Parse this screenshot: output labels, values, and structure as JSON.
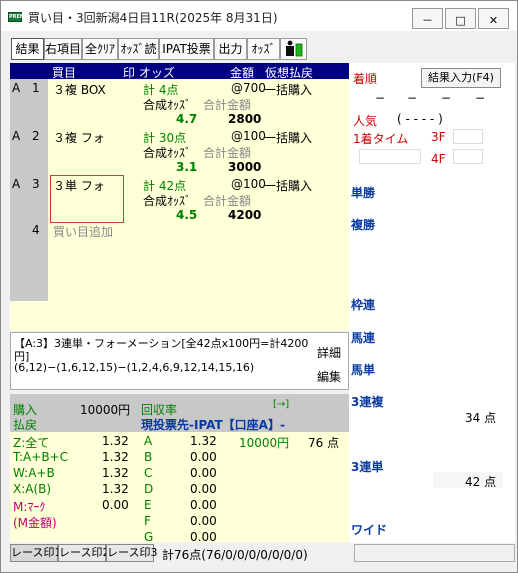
{
  "window": {
    "title": "買い目・3回新潟4日目11R(2025年 8月31日)",
    "app_icon_label": "PREM",
    "controls": {
      "minimize": "－",
      "maximize": "□",
      "close": "✕"
    }
  },
  "toolbar": {
    "buttons": [
      "結果",
      "右項目",
      "全ｸﾘｱ",
      "ｵｯｽﾞ読",
      "IPAT投票",
      "出力",
      "ｵｯｽﾞ"
    ]
  },
  "grid_header": {
    "col1": "買目",
    "col2": "印 オッズ",
    "col3": "金額",
    "col4": "仮想払戻"
  },
  "bets": [
    {
      "group": "A",
      "no": "1",
      "type": "３複 BOX",
      "count": "計  4点",
      "price": "@700",
      "mode": "一括購入",
      "odds_label": "合成ｵｯｽﾞ",
      "total_label": "合計金額",
      "odds": "4.7",
      "total": "2800"
    },
    {
      "group": "A",
      "no": "2",
      "type": "３複 フォ",
      "count": "計 30点",
      "price": "@100",
      "mode": "一括購入",
      "odds_label": "合成ｵｯｽﾞ",
      "total_label": "合計金額",
      "odds": "3.1",
      "total": "3000"
    },
    {
      "group": "A",
      "no": "3",
      "type": "３単 フォ",
      "count": "計 42点",
      "price": "@100",
      "mode": "一括購入",
      "odds_label": "合成ｵｯｽﾞ",
      "total_label": "合計金額",
      "odds": "4.5",
      "total": "4200"
    }
  ],
  "add_row": {
    "no": "4",
    "label": "買い目追加"
  },
  "info": {
    "line1": "【A:3】3連単・フォーメーション[全42点x100円=計4200",
    "line2": "円]",
    "line3": "(6,12)−(1,6,12,15)−(1,2,4,6,9,12,14,15,16)",
    "detail_btn": "詳細",
    "edit_btn": "編集"
  },
  "summary": {
    "purchase_label": "購入",
    "purchase_value": "10000円",
    "refund_label": "払戻",
    "recovery_label": "回収率",
    "arrow": "[→]",
    "vote_dest": "現投票先-IPAT【口座A】-"
  },
  "marks": [
    {
      "label": "Z:全て",
      "val": "1.32",
      "letter": "A",
      "val2": "1.32",
      "amount": "10000円",
      "points": "76 点"
    },
    {
      "label": "T:A+B+C",
      "val": "1.32",
      "letter": "B",
      "val2": "0.00",
      "amount": "",
      "points": ""
    },
    {
      "label": "W:A+B",
      "val": "1.32",
      "letter": "C",
      "val2": "0.00",
      "amount": "",
      "points": ""
    },
    {
      "label": "X:A(B)",
      "val": "1.32",
      "letter": "D",
      "val2": "0.00",
      "amount": "",
      "points": ""
    },
    {
      "label": "M:ﾏｰｸ",
      "val": "0.00",
      "letter": "E",
      "val2": "0.00",
      "amount": "",
      "points": ""
    },
    {
      "label": "(M金額)",
      "val": "",
      "letter": "F",
      "val2": "0.00",
      "amount": "",
      "points": ""
    },
    {
      "label": "",
      "val": "",
      "letter": "G",
      "val2": "0.00",
      "amount": "",
      "points": ""
    }
  ],
  "right": {
    "chakujun": "着順",
    "result_btn": "結果入力(F4)",
    "placeholders": [
      "−",
      "−",
      "−",
      "−"
    ],
    "ninki": "人気",
    "ninki_row": "( - - - - )",
    "first_time": "1着タイム",
    "f3": "3F",
    "f4": "4F",
    "sections": [
      "単勝",
      "複勝",
      "枠連",
      "馬連",
      "馬単",
      "3連複",
      "3連単",
      "ワイド"
    ],
    "sanrenpuku_points": "34 点",
    "sanrentan_points": "42 点"
  },
  "status": {
    "tabs": [
      "レース印1",
      "レース印2",
      "レース印3"
    ],
    "text": "計76点(76/0/0/0/0/0/0/0)"
  },
  "colors": {
    "header_bg": "#000080",
    "yellow_bg": "#ffffd8",
    "green": "#008000",
    "blue": "#0a3aa0",
    "red": "#d00000"
  }
}
